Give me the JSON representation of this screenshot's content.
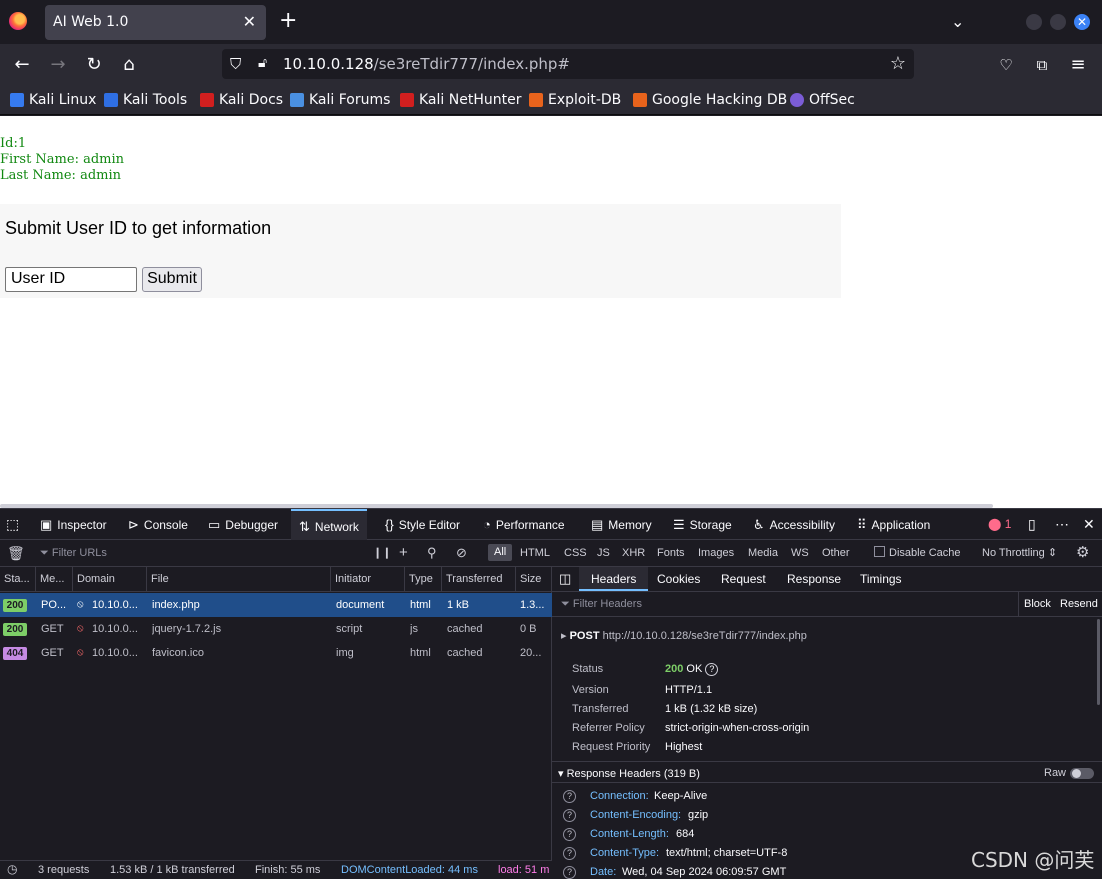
{
  "browser": {
    "tab_title": "AI Web 1.0",
    "url_host": "10.10.0.128",
    "url_path": "/se3reTdir777/index.php#",
    "bookmarks": [
      {
        "label": "Kali Linux",
        "color": "#367bf0"
      },
      {
        "label": "Kali Tools",
        "color": "#2f6fe4"
      },
      {
        "label": "Kali Docs",
        "color": "#d21f1f"
      },
      {
        "label": "Kali Forums",
        "color": "#4a90e2"
      },
      {
        "label": "Kali NetHunter",
        "color": "#d21f1f"
      },
      {
        "label": "Exploit-DB",
        "color": "#e8631c"
      },
      {
        "label": "Google Hacking DB",
        "color": "#e8631c"
      },
      {
        "label": "OffSec",
        "color": "#7b5cd6"
      }
    ]
  },
  "page": {
    "result": {
      "id_line": "Id:1",
      "first_name_line": "First Name: admin",
      "last_name_line": "Last Name: admin"
    },
    "form": {
      "title": "Submit User ID to get information",
      "input_placeholder": "User ID",
      "input_value": "User ID",
      "submit_label": "Submit"
    }
  },
  "devtools": {
    "tabs": [
      "Inspector",
      "Console",
      "Debugger",
      "Network",
      "Style Editor",
      "Performance",
      "Memory",
      "Storage",
      "Accessibility",
      "Application"
    ],
    "error_count": "1",
    "filter_placeholder": "Filter URLs",
    "type_filters": [
      "All",
      "HTML",
      "CSS",
      "JS",
      "XHR",
      "Fonts",
      "Images",
      "Media",
      "WS",
      "Other"
    ],
    "disable_cache_label": "Disable Cache",
    "throttling": "No Throttling",
    "columns": [
      "Sta...",
      "Me...",
      "Domain",
      "File",
      "Initiator",
      "Type",
      "Transferred",
      "Size"
    ],
    "requests": [
      {
        "status": "200",
        "method": "PO...",
        "domain": "10.10.0...",
        "file": "index.php",
        "initiator": "document",
        "type": "html",
        "transferred": "1 kB",
        "size": "1.3...",
        "badge_color": "#7dce67"
      },
      {
        "status": "200",
        "method": "GET",
        "domain": "10.10.0...",
        "file": "jquery-1.7.2.js",
        "initiator": "script",
        "type": "js",
        "transferred": "cached",
        "size": "0 B",
        "badge_color": "#7dce67"
      },
      {
        "status": "404",
        "method": "GET",
        "domain": "10.10.0...",
        "file": "favicon.ico",
        "initiator": "img",
        "type": "html",
        "transferred": "cached",
        "size": "20...",
        "badge_color": "#c58ae3"
      }
    ],
    "detail_tabs": [
      "Headers",
      "Cookies",
      "Request",
      "Response",
      "Timings"
    ],
    "filter_headers_placeholder": "Filter Headers",
    "block_label": "Block",
    "resend_label": "Resend",
    "request_method": "POST",
    "request_url": "http://10.10.0.128/se3reTdir777/index.php",
    "summary": [
      {
        "key": "Status",
        "value": "OK",
        "code": "200"
      },
      {
        "key": "Version",
        "value": "HTTP/1.1"
      },
      {
        "key": "Transferred",
        "value": "1 kB (1.32 kB size)"
      },
      {
        "key": "Referrer Policy",
        "value": "strict-origin-when-cross-origin"
      },
      {
        "key": "Request Priority",
        "value": "Highest"
      }
    ],
    "response_headers_title": "Response Headers (319 B)",
    "raw_label": "Raw",
    "response_headers": [
      {
        "name": "Connection:",
        "value": "Keep-Alive"
      },
      {
        "name": "Content-Encoding:",
        "value": "gzip"
      },
      {
        "name": "Content-Length:",
        "value": "684"
      },
      {
        "name": "Content-Type:",
        "value": "text/html; charset=UTF-8"
      },
      {
        "name": "Date:",
        "value": "Wed, 04 Sep 2024 06:09:57 GMT"
      }
    ],
    "statusbar": {
      "requests": "3 requests",
      "transferred": "1.53 kB / 1 kB transferred",
      "finish": "Finish: 55 ms",
      "dom_loaded": "DOMContentLoaded: 44 ms",
      "load": "load: 51 m"
    }
  },
  "watermark": "CSDN @问芙"
}
